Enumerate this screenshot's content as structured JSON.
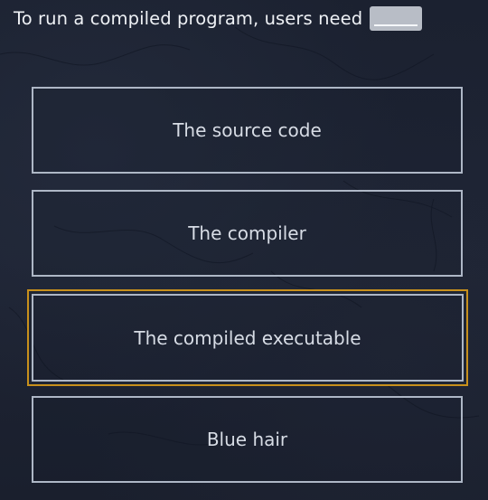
{
  "question": {
    "text": "To run a compiled program, users need",
    "blank": ""
  },
  "options": [
    {
      "label": "The source code",
      "selected": false
    },
    {
      "label": "The compiler",
      "selected": false
    },
    {
      "label": "The compiled executable",
      "selected": true
    },
    {
      "label": "Blue hair",
      "selected": false
    }
  ],
  "colors": {
    "background": "#1c2231",
    "option_border": "#aeb7c6",
    "selected_border": "#c8901c",
    "blank_fill": "#b8bdc6"
  }
}
